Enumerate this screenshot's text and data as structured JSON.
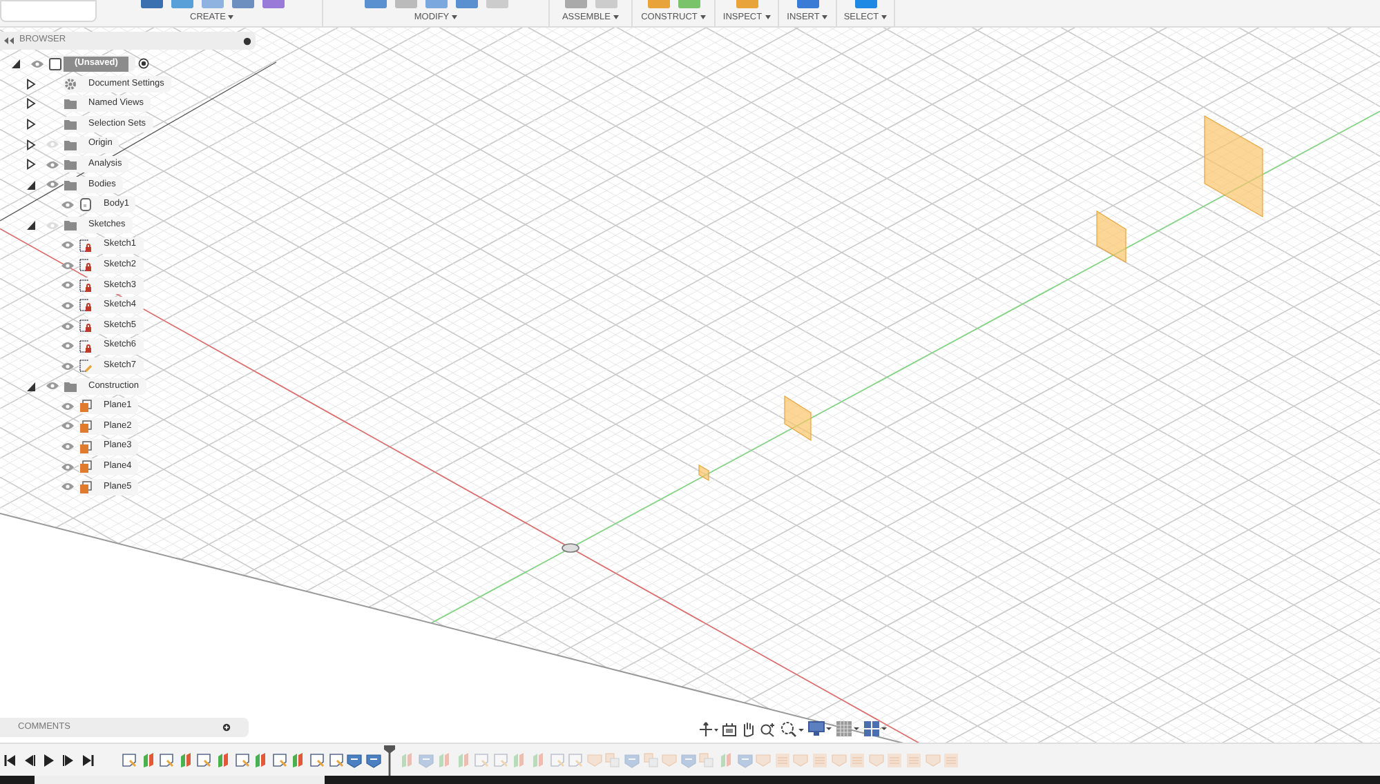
{
  "toolbar": {
    "groups": [
      {
        "label": "CREATE"
      },
      {
        "label": "MODIFY"
      },
      {
        "label": "ASSEMBLE"
      },
      {
        "label": "CONSTRUCT"
      },
      {
        "label": "INSPECT"
      },
      {
        "label": "INSERT"
      },
      {
        "label": "SELECT"
      }
    ]
  },
  "browser": {
    "title": "BROWSER",
    "tree": [
      {
        "label": "(Unsaved)",
        "kind": "component",
        "visible": true,
        "expanded": true,
        "children": [
          {
            "label": "Document Settings",
            "kind": "settings",
            "expanded": false
          },
          {
            "label": "Named Views",
            "kind": "folder",
            "expanded": false
          },
          {
            "label": "Selection Sets",
            "kind": "folder",
            "expanded": false
          },
          {
            "label": "Origin",
            "kind": "folder",
            "visible": false,
            "expanded": false
          },
          {
            "label": "Analysis",
            "kind": "folder",
            "visible": true,
            "expanded": false
          },
          {
            "label": "Bodies",
            "kind": "folder",
            "visible": true,
            "expanded": true,
            "children": [
              {
                "label": "Body1",
                "kind": "body",
                "visible": true
              }
            ]
          },
          {
            "label": "Sketches",
            "kind": "folder",
            "visible": false,
            "expanded": true,
            "children": [
              {
                "label": "Sketch1",
                "kind": "sketch",
                "visible": true
              },
              {
                "label": "Sketch2",
                "kind": "sketch",
                "visible": true
              },
              {
                "label": "Sketch3",
                "kind": "sketch",
                "visible": true
              },
              {
                "label": "Sketch4",
                "kind": "sketch",
                "visible": true
              },
              {
                "label": "Sketch5",
                "kind": "sketch",
                "visible": true
              },
              {
                "label": "Sketch6",
                "kind": "sketch",
                "visible": true
              },
              {
                "label": "Sketch7",
                "kind": "sketch-open",
                "visible": true
              }
            ]
          },
          {
            "label": "Construction",
            "kind": "folder",
            "visible": true,
            "expanded": true,
            "children": [
              {
                "label": "Plane1",
                "kind": "plane",
                "visible": true
              },
              {
                "label": "Plane2",
                "kind": "plane",
                "visible": true
              },
              {
                "label": "Plane3",
                "kind": "plane",
                "visible": true
              },
              {
                "label": "Plane4",
                "kind": "plane",
                "visible": true
              },
              {
                "label": "Plane5",
                "kind": "plane",
                "visible": true
              }
            ]
          }
        ]
      }
    ]
  },
  "comments": {
    "title": "COMMENTS"
  },
  "timeline": {
    "features": [
      {
        "kind": "sketch",
        "rolled_back": false
      },
      {
        "kind": "extrude",
        "rolled_back": false
      },
      {
        "kind": "sketch",
        "rolled_back": false
      },
      {
        "kind": "extrude",
        "rolled_back": false
      },
      {
        "kind": "sketch",
        "rolled_back": false
      },
      {
        "kind": "extrude",
        "rolled_back": false
      },
      {
        "kind": "sketch",
        "rolled_back": false
      },
      {
        "kind": "extrude",
        "rolled_back": false
      },
      {
        "kind": "sketch",
        "rolled_back": false
      },
      {
        "kind": "extrude",
        "rolled_back": false
      },
      {
        "kind": "sketch",
        "rolled_back": false
      },
      {
        "kind": "sketch",
        "rolled_back": false
      },
      {
        "kind": "plane",
        "rolled_back": false
      },
      {
        "kind": "plane",
        "rolled_back": false
      },
      {
        "kind": "extrude",
        "rolled_back": true
      },
      {
        "kind": "plane",
        "rolled_back": true
      },
      {
        "kind": "extrude",
        "rolled_back": true
      },
      {
        "kind": "extrude",
        "rolled_back": true
      },
      {
        "kind": "sketch",
        "rolled_back": true
      },
      {
        "kind": "sketch",
        "rolled_back": true
      },
      {
        "kind": "extrude",
        "rolled_back": true
      },
      {
        "kind": "extrude",
        "rolled_back": true
      },
      {
        "kind": "sketch",
        "rolled_back": true
      },
      {
        "kind": "sketch",
        "rolled_back": true
      },
      {
        "kind": "pocket",
        "rolled_back": true
      },
      {
        "kind": "combine",
        "rolled_back": true
      },
      {
        "kind": "plane",
        "rolled_back": true
      },
      {
        "kind": "combine",
        "rolled_back": true
      },
      {
        "kind": "pocket",
        "rolled_back": true
      },
      {
        "kind": "plane",
        "rolled_back": true
      },
      {
        "kind": "combine",
        "rolled_back": true
      },
      {
        "kind": "extrude",
        "rolled_back": true
      },
      {
        "kind": "plane",
        "rolled_back": true
      },
      {
        "kind": "pocket",
        "rolled_back": true
      },
      {
        "kind": "list",
        "rolled_back": true
      },
      {
        "kind": "pocket",
        "rolled_back": true
      },
      {
        "kind": "list",
        "rolled_back": true
      },
      {
        "kind": "pocket",
        "rolled_back": true
      },
      {
        "kind": "list",
        "rolled_back": true
      },
      {
        "kind": "pocket",
        "rolled_back": true
      },
      {
        "kind": "list",
        "rolled_back": true
      },
      {
        "kind": "list",
        "rolled_back": true
      },
      {
        "kind": "pocket",
        "rolled_back": true
      },
      {
        "kind": "list",
        "rolled_back": true
      }
    ]
  }
}
